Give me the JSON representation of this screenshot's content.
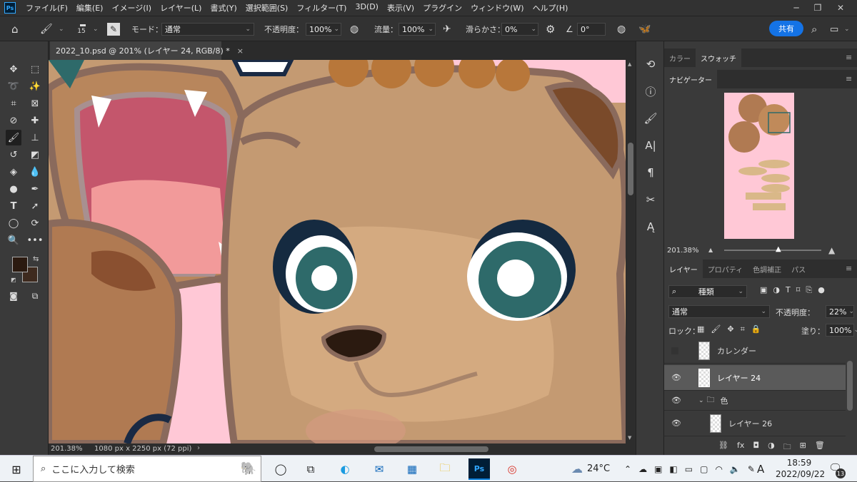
{
  "app": {
    "logo": "Ps"
  },
  "menubar": {
    "items": [
      "ファイル(F)",
      "編集(E)",
      "イメージ(I)",
      "レイヤー(L)",
      "書式(Y)",
      "選択範囲(S)",
      "フィルター(T)",
      "3D(D)",
      "表示(V)",
      "プラグイン",
      "ウィンドウ(W)",
      "ヘルプ(H)"
    ]
  },
  "options": {
    "brush_size": "15",
    "mode_label": "モード：",
    "mode_value": "通常",
    "opacity_label": "不透明度：",
    "opacity_value": "100%",
    "flow_label": "流量：",
    "flow_value": "100%",
    "smoothing_label": "滑らかさ：",
    "smoothing_value": "0%",
    "angle_value": "0°",
    "share_label": "共有"
  },
  "document": {
    "tab_title": "2022_10.psd @ 201% (レイヤー 24, RGB/8) *",
    "close": "×",
    "zoom": "201.38%",
    "dimensions": "1080 px x 2250 px (72 ppi)"
  },
  "colors": {
    "foreground": "#2b1a10",
    "background": "#3e2a1e",
    "accent": "#1473e6",
    "canvas_pink": "#ffc8d6"
  },
  "panels": {
    "top_tabs": [
      "カラー",
      "スウォッチ"
    ],
    "navigator_title": "ナビゲーター",
    "navigator_zoom": "201.38%",
    "layer_tabs": [
      "レイヤー",
      "プロパティ",
      "色調補正",
      "パス"
    ],
    "filter_kind": "種類",
    "blend_mode": "通常",
    "opacity_label": "不透明度：",
    "opacity_value": "22%",
    "lock_label": "ロック：",
    "fill_label": "塗り：",
    "fill_value": "100%",
    "layers": [
      {
        "name": "カレンダー",
        "visible": false,
        "selected": false
      },
      {
        "name": "レイヤー 24",
        "visible": true,
        "selected": true
      },
      {
        "name": "色",
        "visible": true,
        "selected": false,
        "group": true
      },
      {
        "name": "レイヤー 26",
        "visible": true,
        "selected": false
      }
    ]
  },
  "taskbar": {
    "search_placeholder": "ここに入力して検索",
    "temperature": "24°C",
    "time": "18:59",
    "date": "2022/09/22",
    "ime": "A",
    "notifications": "13",
    "apps": [
      "task-view",
      "edge",
      "mail",
      "store",
      "explorer",
      "photoshop",
      "chrome"
    ]
  }
}
